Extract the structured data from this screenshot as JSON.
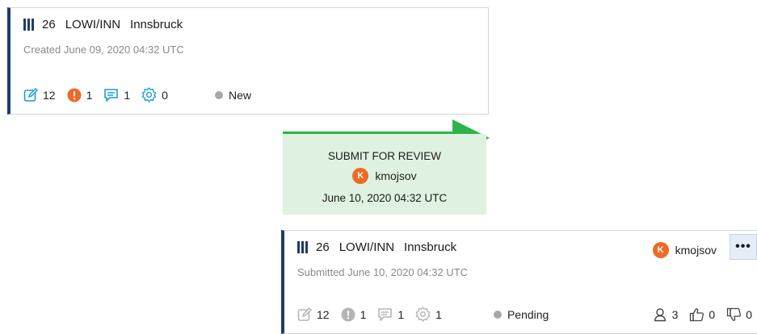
{
  "card_created": {
    "number": "26",
    "name_code": "LOWI/INN",
    "name_city": "Innsbruck",
    "created_text": "Created June 09, 2020 04:32 UTC",
    "edits": "12",
    "alerts": "1",
    "comments": "1",
    "settings": "0",
    "status": "New"
  },
  "transition": {
    "action": "SUBMIT FOR REVIEW",
    "user_initial": "K",
    "user": "kmojsov",
    "date": "June 10, 2020 04:32 UTC"
  },
  "card_submitted": {
    "number": "26",
    "name_code": "LOWI/INN",
    "name_city": "Innsbruck",
    "submitted_text": "Submitted June 10, 2020 04:32 UTC",
    "owner_initial": "K",
    "owner": "kmojsov",
    "more_label": "•••",
    "edits": "12",
    "alerts": "1",
    "comments": "1",
    "settings": "1",
    "status": "Pending",
    "reviewers": "3",
    "likes": "0",
    "dislikes": "0"
  },
  "colors": {
    "accent_bar": "#1f3a6e",
    "edit_icon_active": "#1a9bd7",
    "alert_active": "#ef6a25",
    "transition_bg": "#dff2e1",
    "arrow": "#2db34a",
    "avatar": "#ef6a25",
    "inactive_icon": "#b5b5b5"
  }
}
